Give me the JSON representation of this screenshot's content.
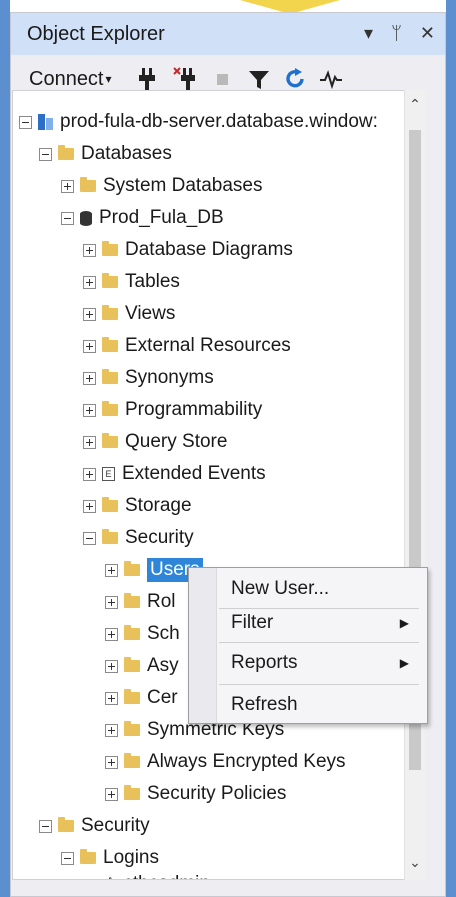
{
  "panel": {
    "title": "Object Explorer",
    "controls": [
      "▾",
      "ᛘ",
      "✕"
    ]
  },
  "toolbar": {
    "connect_label": "Connect"
  },
  "tree": {
    "server": "prod-fula-db-server.database.window:",
    "databases": "Databases",
    "system_databases": "System Databases",
    "db_name": "Prod_Fula_DB",
    "db_children": [
      "Database Diagrams",
      "Tables",
      "Views",
      "External Resources",
      "Synonyms",
      "Programmability",
      "Query Store",
      "Extended Events",
      "Storage",
      "Security"
    ],
    "security_children": [
      "Users",
      "Rol",
      "Sch",
      "Asy",
      "Cer",
      "Symmetric Keys",
      "Always Encrypted Keys",
      "Security Policies"
    ],
    "server_security": "Security",
    "logins": "Logins",
    "login_user": "ctbcadmin"
  },
  "context_menu": {
    "items": [
      "New User...",
      "Filter",
      "Reports",
      "Refresh"
    ]
  },
  "colors": {
    "accent": "#2f86d8",
    "title_bar": "#cfe0f7",
    "folder": "#e8c15a"
  }
}
